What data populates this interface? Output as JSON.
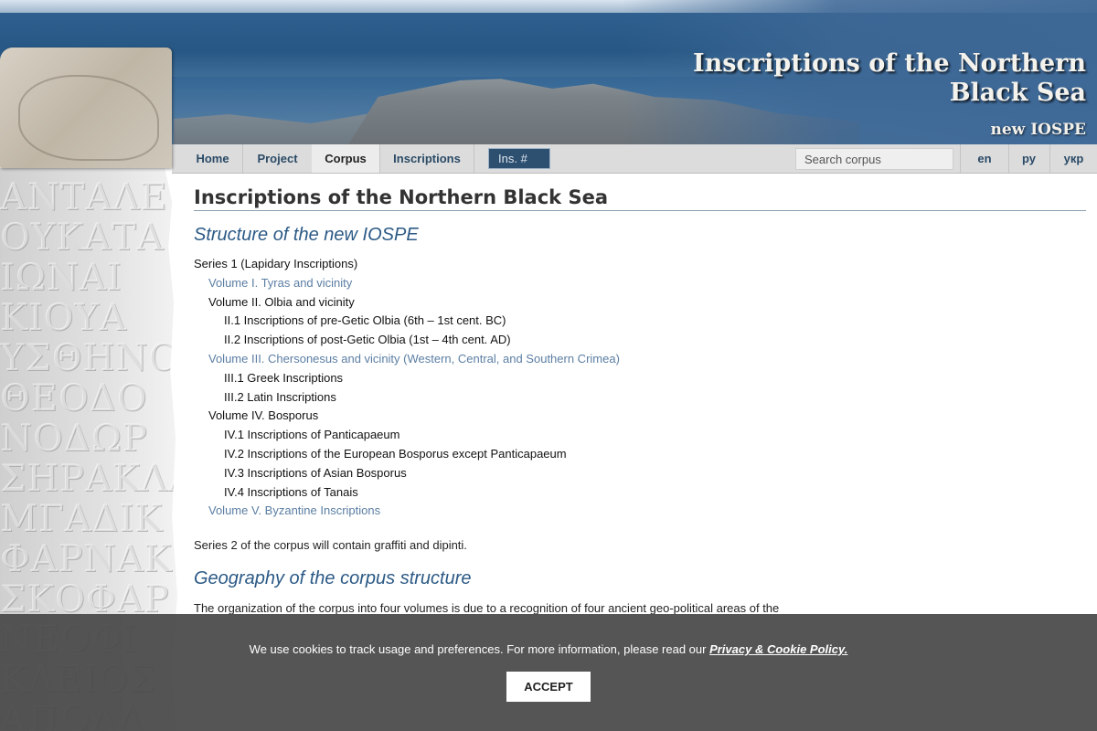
{
  "site": {
    "title": "Inscriptions of the Northern Black Sea",
    "subtitle": "new IOSPE"
  },
  "nav": {
    "items": [
      {
        "label": "Home"
      },
      {
        "label": "Project"
      },
      {
        "label": "Corpus"
      },
      {
        "label": "Inscriptions"
      }
    ],
    "active": "Corpus",
    "ins_placeholder": "Ins. #",
    "search_placeholder": "Search corpus",
    "languages": [
      {
        "label": "en"
      },
      {
        "label": "ру"
      },
      {
        "label": "укр"
      }
    ]
  },
  "main": {
    "title": "Inscriptions of the Northern Black Sea",
    "structure_heading": "Structure of the new IOSPE",
    "tree": [
      {
        "text": "Series 1 (Lapidary Inscriptions)"
      },
      {
        "text": "Volume I. Tyras and vicinity"
      },
      {
        "text": "Volume II. Olbia and vicinity"
      },
      {
        "text": "II.1 Inscriptions of pre-Getic Olbia (6th – 1st cent. BC)"
      },
      {
        "text": "II.2 Inscriptions of post-Getic Olbia (1st – 4th cent. AD)"
      },
      {
        "text": "Volume III. Chersonesus and vicinity (Western, Central, and Southern Crimea)"
      },
      {
        "text": "III.1 Greek Inscriptions"
      },
      {
        "text": "III.2 Latin Inscriptions"
      },
      {
        "text": "Volume IV. Bosporus"
      },
      {
        "text": "IV.1 Inscriptions of Panticapaeum"
      },
      {
        "text": "IV.2 Inscriptions of the European Bosporus except Panticapaeum"
      },
      {
        "text": "IV.3 Inscriptions of Asian Bosporus"
      },
      {
        "text": "IV.4 Inscriptions of Tanais"
      },
      {
        "text": "Volume V. Byzantine Inscriptions"
      }
    ],
    "series2": "Series 2 of the corpus will contain graffiti and dipinti.",
    "geo_heading": "Geography of the corpus structure",
    "geo_p1": "The organization of the corpus into four volumes is due to a recognition of four ancient geo-political areas of the",
    "geo_p2": ""
  },
  "cookie": {
    "text": "We use cookies to track usage and preferences. For more information, please read our",
    "link": "Privacy & Cookie Policy.",
    "accept": "ACCEPT"
  }
}
